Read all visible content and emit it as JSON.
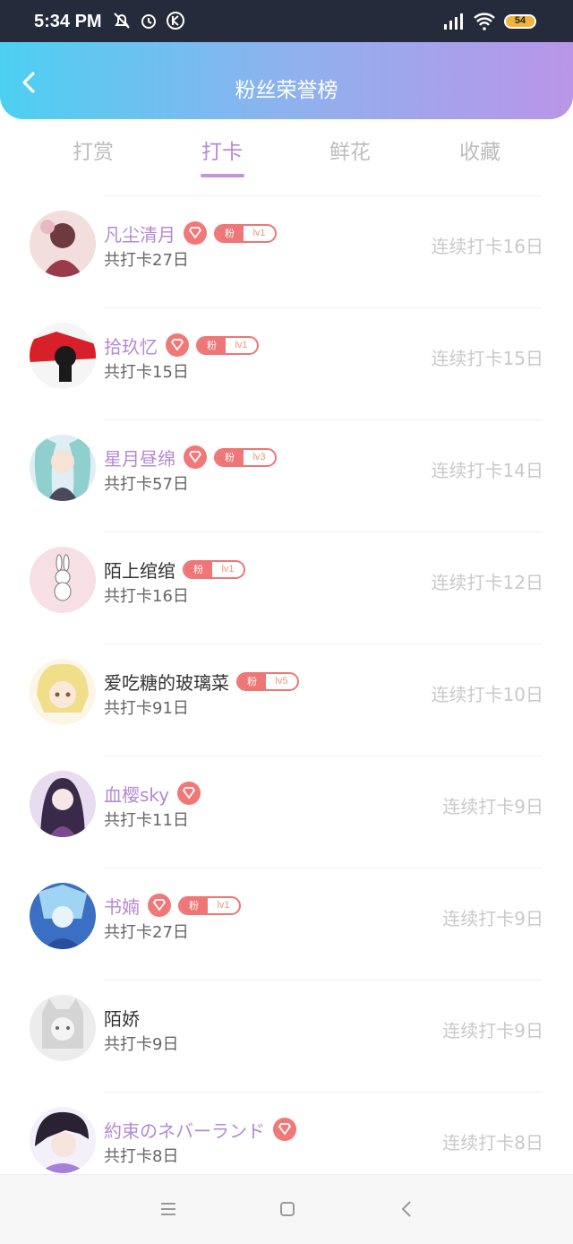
{
  "status_bar": {
    "time": "5:34 PM",
    "battery": "54",
    "icons": [
      "mute-icon",
      "alarm-icon",
      "k-badge-icon",
      "signal-icon",
      "wifi-icon",
      "battery-icon"
    ]
  },
  "header": {
    "title": "粉丝荣誉榜",
    "back_icon": "chevron-left-icon"
  },
  "tabs": [
    {
      "label": "打赏",
      "active": false
    },
    {
      "label": "打卡",
      "active": true
    },
    {
      "label": "鲜花",
      "active": false
    },
    {
      "label": "收藏",
      "active": false
    }
  ],
  "colors": {
    "header_gradient": [
      "#4cd0f2",
      "#8eb2ee",
      "#b995e8"
    ],
    "accent_purple": "#b489d3",
    "badge_red": "#ee7676",
    "muted_text": "#c9c9c9"
  },
  "fan_badge_label": "粉",
  "rows": [
    {
      "name": "凡尘清月",
      "vip": true,
      "gem": true,
      "fan_level": "lv1",
      "total": "共打卡27日",
      "streak": "连续打卡16日"
    },
    {
      "name": "拾玖忆",
      "vip": true,
      "gem": true,
      "fan_level": "lv1",
      "total": "共打卡15日",
      "streak": "连续打卡15日"
    },
    {
      "name": "星月昼绵",
      "vip": true,
      "gem": true,
      "fan_level": "lv3",
      "total": "共打卡57日",
      "streak": "连续打卡14日"
    },
    {
      "name": "陌上绾绾",
      "vip": false,
      "gem": false,
      "fan_level": "lv1",
      "total": "共打卡16日",
      "streak": "连续打卡12日"
    },
    {
      "name": "爱吃糖的玻璃菜",
      "vip": false,
      "gem": false,
      "fan_level": "lv5",
      "total": "共打卡91日",
      "streak": "连续打卡10日"
    },
    {
      "name": "血樱sky",
      "vip": true,
      "gem": true,
      "fan_level": "",
      "total": "共打卡11日",
      "streak": "连续打卡9日"
    },
    {
      "name": "书婻",
      "vip": true,
      "gem": true,
      "fan_level": "lv1",
      "total": "共打卡27日",
      "streak": "连续打卡9日"
    },
    {
      "name": "陌娇",
      "vip": false,
      "gem": false,
      "fan_level": "",
      "total": "共打卡9日",
      "streak": "连续打卡9日"
    },
    {
      "name": "約束のネバーランド",
      "vip": true,
      "gem": true,
      "fan_level": "",
      "total": "共打卡8日",
      "streak": "连续打卡8日"
    }
  ],
  "nav_bar": {
    "icons": [
      "menu-icon",
      "home-icon",
      "back-icon"
    ]
  }
}
